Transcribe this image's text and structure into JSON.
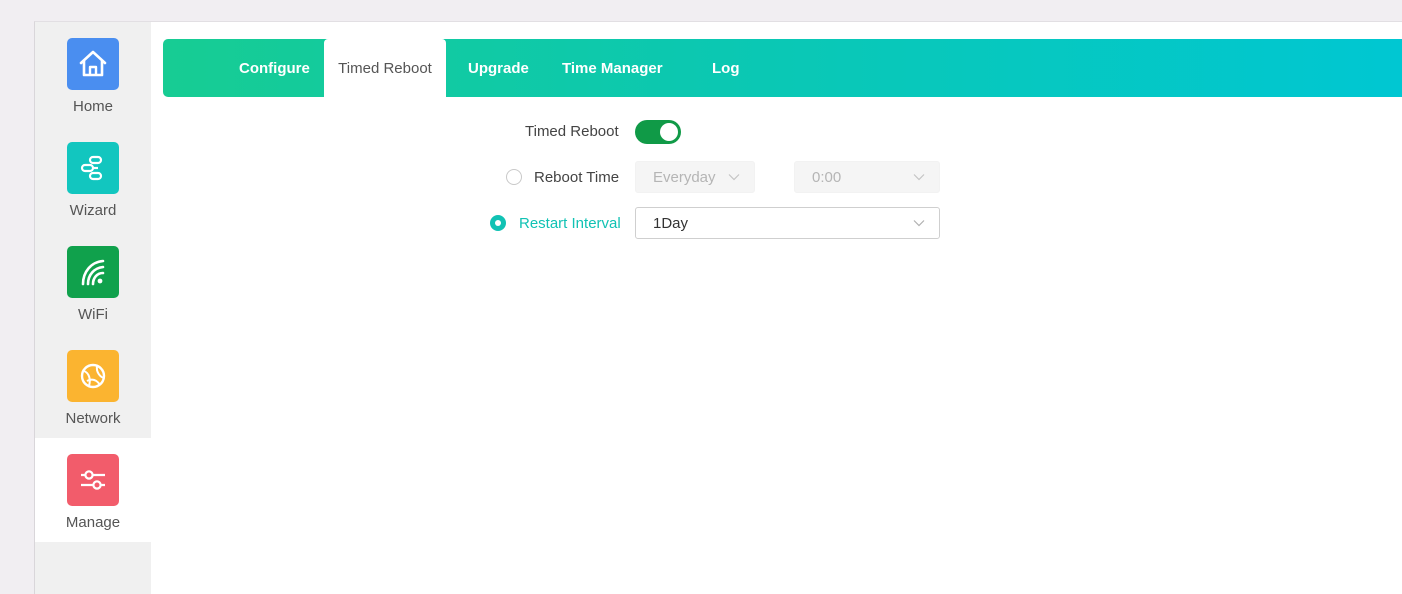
{
  "sidebar": {
    "items": [
      {
        "label": "Home",
        "icon": "home-icon",
        "color": "#4a8ef0"
      },
      {
        "label": "Wizard",
        "icon": "wizard-icon",
        "color": "#12c6bf"
      },
      {
        "label": "WiFi",
        "icon": "wifi-icon",
        "color": "#10a14c"
      },
      {
        "label": "Network",
        "icon": "globe-icon",
        "color": "#fbb430"
      },
      {
        "label": "Manage",
        "icon": "sliders-icon",
        "color": "#f25c6b"
      }
    ],
    "active": "Manage"
  },
  "tabs": [
    {
      "label": "Configure"
    },
    {
      "label": "Timed Reboot"
    },
    {
      "label": "Upgrade"
    },
    {
      "label": "Time Manager"
    },
    {
      "label": "Log"
    }
  ],
  "active_tab": "Timed Reboot",
  "form": {
    "timed_reboot_label": "Timed Reboot",
    "timed_reboot_enabled": true,
    "reboot_time_label": "Reboot Time",
    "reboot_time_selected": false,
    "reboot_day_value": "Everyday",
    "reboot_clock_value": "0:00",
    "restart_interval_label": "Restart Interval",
    "restart_interval_selected": true,
    "restart_interval_value": "1Day"
  },
  "colors": {
    "accent": "#11c2b4",
    "toggle_on": "#109a47"
  }
}
